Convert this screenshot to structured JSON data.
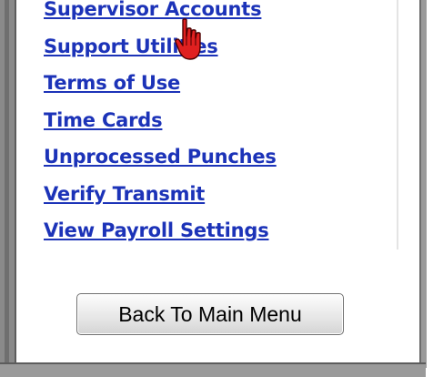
{
  "links": [
    {
      "label": "Supervisor Accounts"
    },
    {
      "label": "Support Utilities"
    },
    {
      "label": "Terms of Use"
    },
    {
      "label": "Time Cards"
    },
    {
      "label": "Unprocessed Punches"
    },
    {
      "label": "Verify Transmit"
    },
    {
      "label": "View Payroll Settings"
    }
  ],
  "back_button": {
    "label": "Back To Main Menu"
  },
  "colors": {
    "link": "#1c33b8",
    "frame": "#8a8a8a",
    "cursor": "#e02020"
  },
  "cursor_icon": "hand-pointer-icon"
}
